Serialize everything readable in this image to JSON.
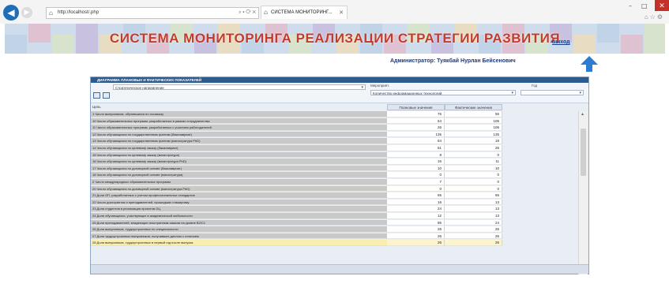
{
  "browser": {
    "url": "http://localhost/.php",
    "tab_title": "СИСТЕМА МОНИТОРИНГ...",
    "icons": [
      "back-arrow-icon",
      "forward-arrow-icon",
      "search-icon",
      "refresh-icon",
      "close-icon",
      "home-icon",
      "star-icon",
      "gear-icon"
    ]
  },
  "banner": {
    "title": "СИСТЕМА МОНИТОРИНГА РЕАЛИЗАЦИИ СТРАТЕГИИ РАЗВИТИЯ",
    "exit_label": "выход",
    "title_color": "#c53b2a",
    "tile_colors": [
      "#bcd0e6",
      "#e4b9c8",
      "#d9e6c2",
      "#c6b8dc",
      "#f0dcb4"
    ]
  },
  "user": {
    "admin_label": "Администратор: Туякбай Нурлан Бейсенович"
  },
  "panel": {
    "title": "ДИАГРАММА ПЛАНОВЫХ И ФАКТИЧЕСКИХ ПОКАЗАТЕЛЕЙ",
    "filter1_value": "Стратегическое направление",
    "filter2_label": "Мероприят.",
    "filter2_value": "Количество информационных технологий",
    "filter3_label": "Год",
    "filter3_value": "",
    "grid_header_label": "Цель",
    "col_plan": "Плановые значения",
    "col_fact": "Фактические значения",
    "header_color": "#2e5b8e"
  },
  "rows": [
    {
      "label": "1 Число выпускников, обучившихся по госзаказу",
      "plan": "76",
      "fact": "56"
    },
    {
      "label": "10 Число образовательных программ, разработанных в рамках сотрудничества",
      "plan": "64",
      "fact": "106"
    },
    {
      "label": "11 Число образовательных программ, разработанных с участием работодателей",
      "plan": "26",
      "fact": "106"
    },
    {
      "label": "12 Число обучающихся по государственным грантам (бакалавриат)",
      "plan": "135",
      "fact": "135"
    },
    {
      "label": "13 Число обучающихся по государственным грантам (магистратура PhD)",
      "plan": "64",
      "fact": "18"
    },
    {
      "label": "14 Число обучающихся по целевому заказу (бакалавриат)",
      "plan": "51",
      "fact": "26"
    },
    {
      "label": "15 Число обучающихся по целевому заказу (магистратура)",
      "plan": "8",
      "fact": "0"
    },
    {
      "label": "16 Число обучающихся по целевому заказу (магистратура PhD)",
      "plan": "16",
      "fact": "11"
    },
    {
      "label": "17 Число обучающихся по договорной основе (бакалавриат)",
      "plan": "10",
      "fact": "10"
    },
    {
      "label": "18 Число обучающихся по договорной основе (магистратура)",
      "plan": "0",
      "fact": "0"
    },
    {
      "label": "2 Число международных образовательных программ",
      "plan": "7",
      "fact": "0"
    },
    {
      "label": "20 Число обучающихся по договорной основе (магистратура PhD)",
      "plan": "0",
      "fact": "0"
    },
    {
      "label": "21 Доля ОП, разработанных с учетом профессиональных стандартов",
      "plan": "65",
      "fact": "65"
    },
    {
      "label": "22 Число докторантов и преподавателей, прошедших стажировку",
      "plan": "16",
      "fact": "13"
    },
    {
      "label": "23 Доля студентов в реализации проектов ОЦ",
      "plan": "24",
      "fact": "13"
    },
    {
      "label": "24 Доля обучающихся, участвующих в академической мобильности",
      "plan": "12",
      "fact": "13"
    },
    {
      "label": "25 Доля преподавателей, владеющих иностранным языком на уровне B2/C1",
      "plan": "86",
      "fact": "24"
    },
    {
      "label": "26 Доля выпускников, трудоустроенных по специальности",
      "plan": "26",
      "fact": "26"
    },
    {
      "label": "27 Доля трудоустроенных выпускников, получивших диплом с отличием",
      "plan": "26",
      "fact": "26"
    },
    {
      "label": "28 Доля выпускников, трудоустроенных в первый год после выпуска",
      "plan": "26",
      "fact": "26"
    }
  ]
}
